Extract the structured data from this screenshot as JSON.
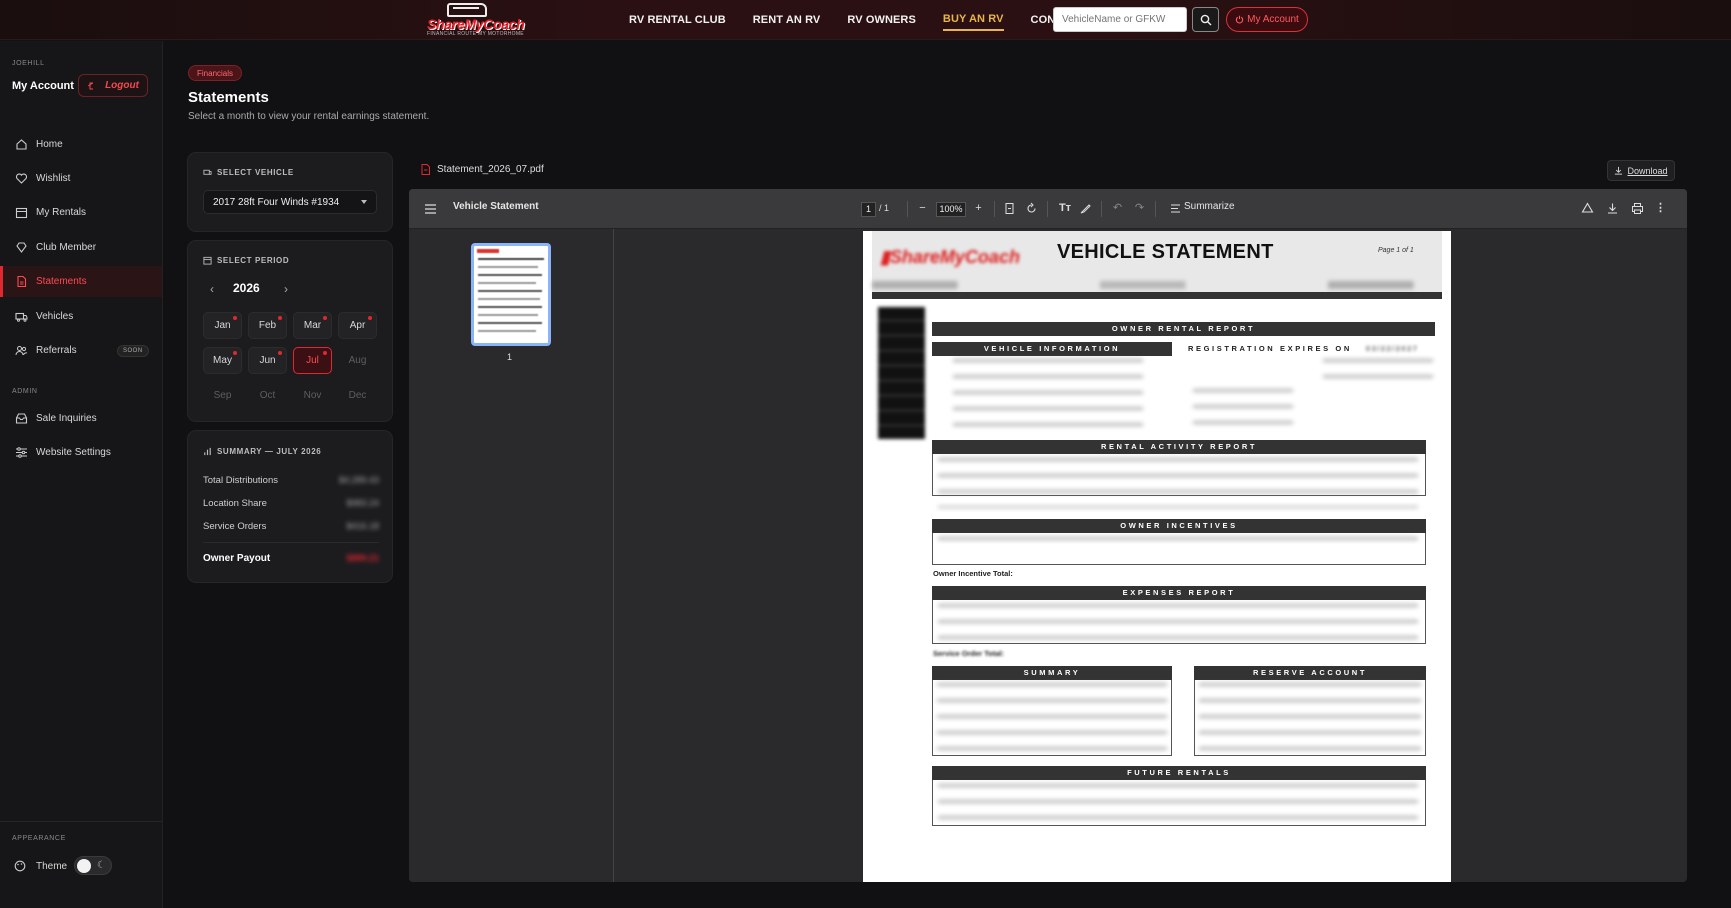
{
  "nav": {
    "logo_text": "ShareMyCoach",
    "logo_tagline": "FINANCIAL ROUTE MY MOTORHOME",
    "links": [
      "RV RENTAL CLUB",
      "RENT AN RV",
      "RV OWNERS",
      "BUY AN RV",
      "CONTACT"
    ],
    "active_link": "BUY AN RV",
    "search_placeholder": "VehicleName or GFKW",
    "my_account": "My Account",
    "accent_color": "#e02830",
    "active_link_color": "#e8b54a"
  },
  "sidebar": {
    "username": "JOEHILL",
    "account_label": "My Account",
    "logout_label": "Logout",
    "items": [
      {
        "label": "Home",
        "icon": "home-icon"
      },
      {
        "label": "Wishlist",
        "icon": "heart-icon"
      },
      {
        "label": "My Rentals",
        "icon": "calendar-icon"
      },
      {
        "label": "Club Member",
        "icon": "diamond-icon"
      },
      {
        "label": "Statements",
        "icon": "document-icon",
        "active": true
      },
      {
        "label": "Vehicles",
        "icon": "truck-icon"
      },
      {
        "label": "Referrals",
        "icon": "users-icon",
        "badge": "SOON"
      }
    ],
    "admin_section": "ADMIN",
    "admin_items": [
      {
        "label": "Sale Inquiries",
        "icon": "inbox-icon"
      },
      {
        "label": "Website Settings",
        "icon": "sliders-icon"
      }
    ],
    "appearance_section": "APPEARANCE",
    "theme_label": "Theme"
  },
  "header": {
    "badge": "Financials",
    "title": "Statements",
    "subtitle": "Select a month to view your rental earnings statement."
  },
  "vehicle_card": {
    "heading": "SELECT VEHICLE",
    "selected": "2017 28ft Four Winds #1934"
  },
  "period_card": {
    "heading": "SELECT PERIOD",
    "year": "2026",
    "months": [
      {
        "label": "Jan",
        "dot": true,
        "state": "normal"
      },
      {
        "label": "Feb",
        "dot": true,
        "state": "normal"
      },
      {
        "label": "Mar",
        "dot": true,
        "state": "normal"
      },
      {
        "label": "Apr",
        "dot": true,
        "state": "normal"
      },
      {
        "label": "May",
        "dot": true,
        "state": "normal"
      },
      {
        "label": "Jun",
        "dot": true,
        "state": "normal"
      },
      {
        "label": "Jul",
        "dot": true,
        "state": "selected"
      },
      {
        "label": "Aug",
        "dot": false,
        "state": "disabled"
      },
      {
        "label": "Sep",
        "dot": false,
        "state": "disabled"
      },
      {
        "label": "Oct",
        "dot": false,
        "state": "disabled"
      },
      {
        "label": "Nov",
        "dot": false,
        "state": "disabled"
      },
      {
        "label": "Dec",
        "dot": false,
        "state": "disabled"
      }
    ]
  },
  "summary_card": {
    "heading": "SUMMARY — JULY 2026",
    "rows": [
      {
        "label": "Total Distributions",
        "value": "$4,289.43"
      },
      {
        "label": "Location Share",
        "value": "$983.24"
      },
      {
        "label": "Service Orders",
        "value": "$416.18"
      }
    ],
    "payout_label": "Owner Payout",
    "payout_value": "$889.21"
  },
  "pdf": {
    "filename": "Statement_2026_07.pdf",
    "download_label": "Download",
    "viewer_title": "Vehicle Statement",
    "page_current": "1",
    "page_total": "/ 1",
    "zoom": "100%",
    "summarize_label": "Summarize",
    "thumb_number": "1",
    "doc": {
      "title": "VEHICLE STATEMENT",
      "page_of": "Page   1  of  1",
      "section_owner": "OWNER RENTAL REPORT",
      "section_vehicle": "VEHICLE INFORMATION",
      "registration": "REGISTRATION EXPIRES ON",
      "registration_date": "03/22/2027",
      "section_rental": "RENTAL ACTIVITY REPORT",
      "section_incentives": "OWNER INCENTIVES",
      "incentive_total": "Owner Incentive Total:",
      "section_expenses": "EXPENSES REPORT",
      "service_total": "Service Order Total:",
      "section_summary": "SUMMARY",
      "section_reserve": "RESERVE ACCOUNT",
      "section_future": "FUTURE RENTALS"
    }
  }
}
